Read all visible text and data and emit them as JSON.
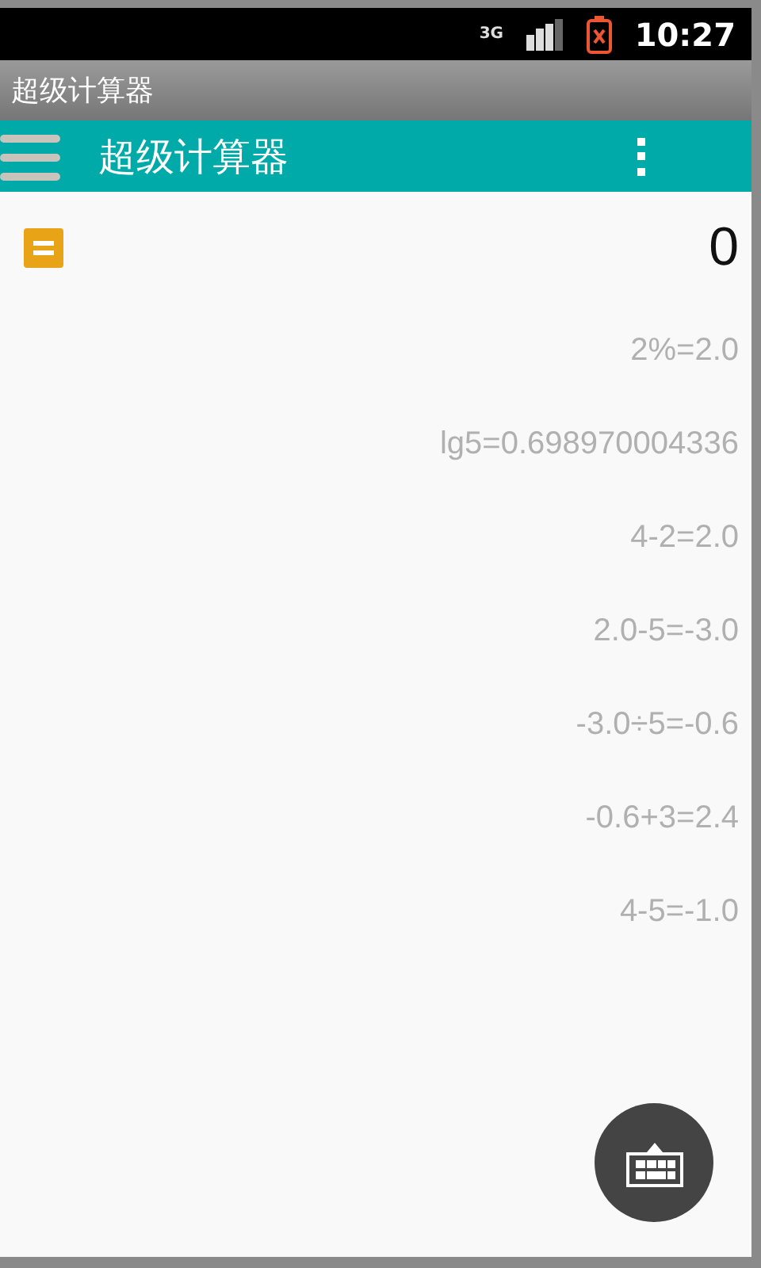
{
  "status_bar": {
    "network": "3G",
    "time": "10:27"
  },
  "window": {
    "title": "超级计算器"
  },
  "toolbar": {
    "title": "超级计算器"
  },
  "display": {
    "value": "0"
  },
  "history": [
    "2%=2.0",
    "lg5=0.698970004336",
    "4-2=2.0",
    "2.0-5=-3.0",
    "-3.0÷5=-0.6",
    "-0.6+3=2.4",
    "4-5=-1.0"
  ]
}
